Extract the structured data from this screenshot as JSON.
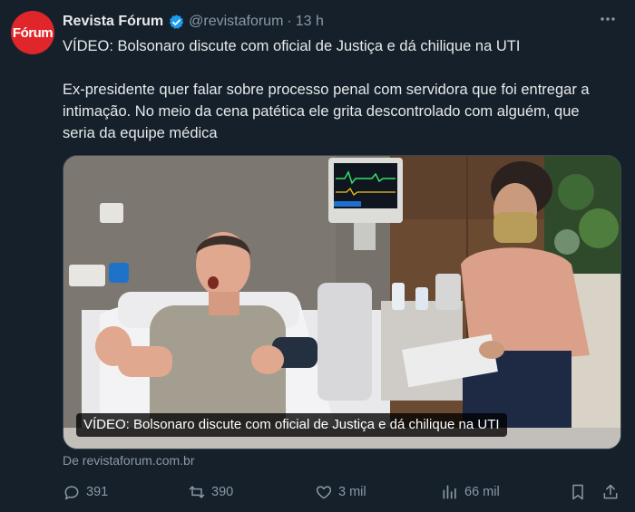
{
  "author": {
    "name": "Revista Fórum",
    "handle": "@revistaforum",
    "separator": "·",
    "time": "13 h",
    "avatar_text": "Fórum"
  },
  "tweet": {
    "title": "VÍDEO: Bolsonaro discute com oficial de Justiça e dá chilique na UTI",
    "body": "Ex-presidente quer falar sobre processo penal com servidora que foi entregar a intimação. No meio da cena patética ele grita descontrolado com alguém, que seria da equipe médica"
  },
  "media": {
    "caption": "VÍDEO: Bolsonaro discute com oficial de Justiça e dá chilique na UTI"
  },
  "source": "De revistaforum.com.br",
  "actions": {
    "replies": "391",
    "retweets": "390",
    "likes": "3 mil",
    "views": "66 mil"
  },
  "colors": {
    "background": "#15202b",
    "text": "#e7e9ea",
    "muted": "#8b98a5",
    "verified": "#1d9bf0",
    "brand": "#e0262b"
  },
  "icons": [
    "more-icon",
    "verified-icon",
    "reply-icon",
    "retweet-icon",
    "like-icon",
    "views-icon",
    "bookmark-icon",
    "share-icon"
  ]
}
